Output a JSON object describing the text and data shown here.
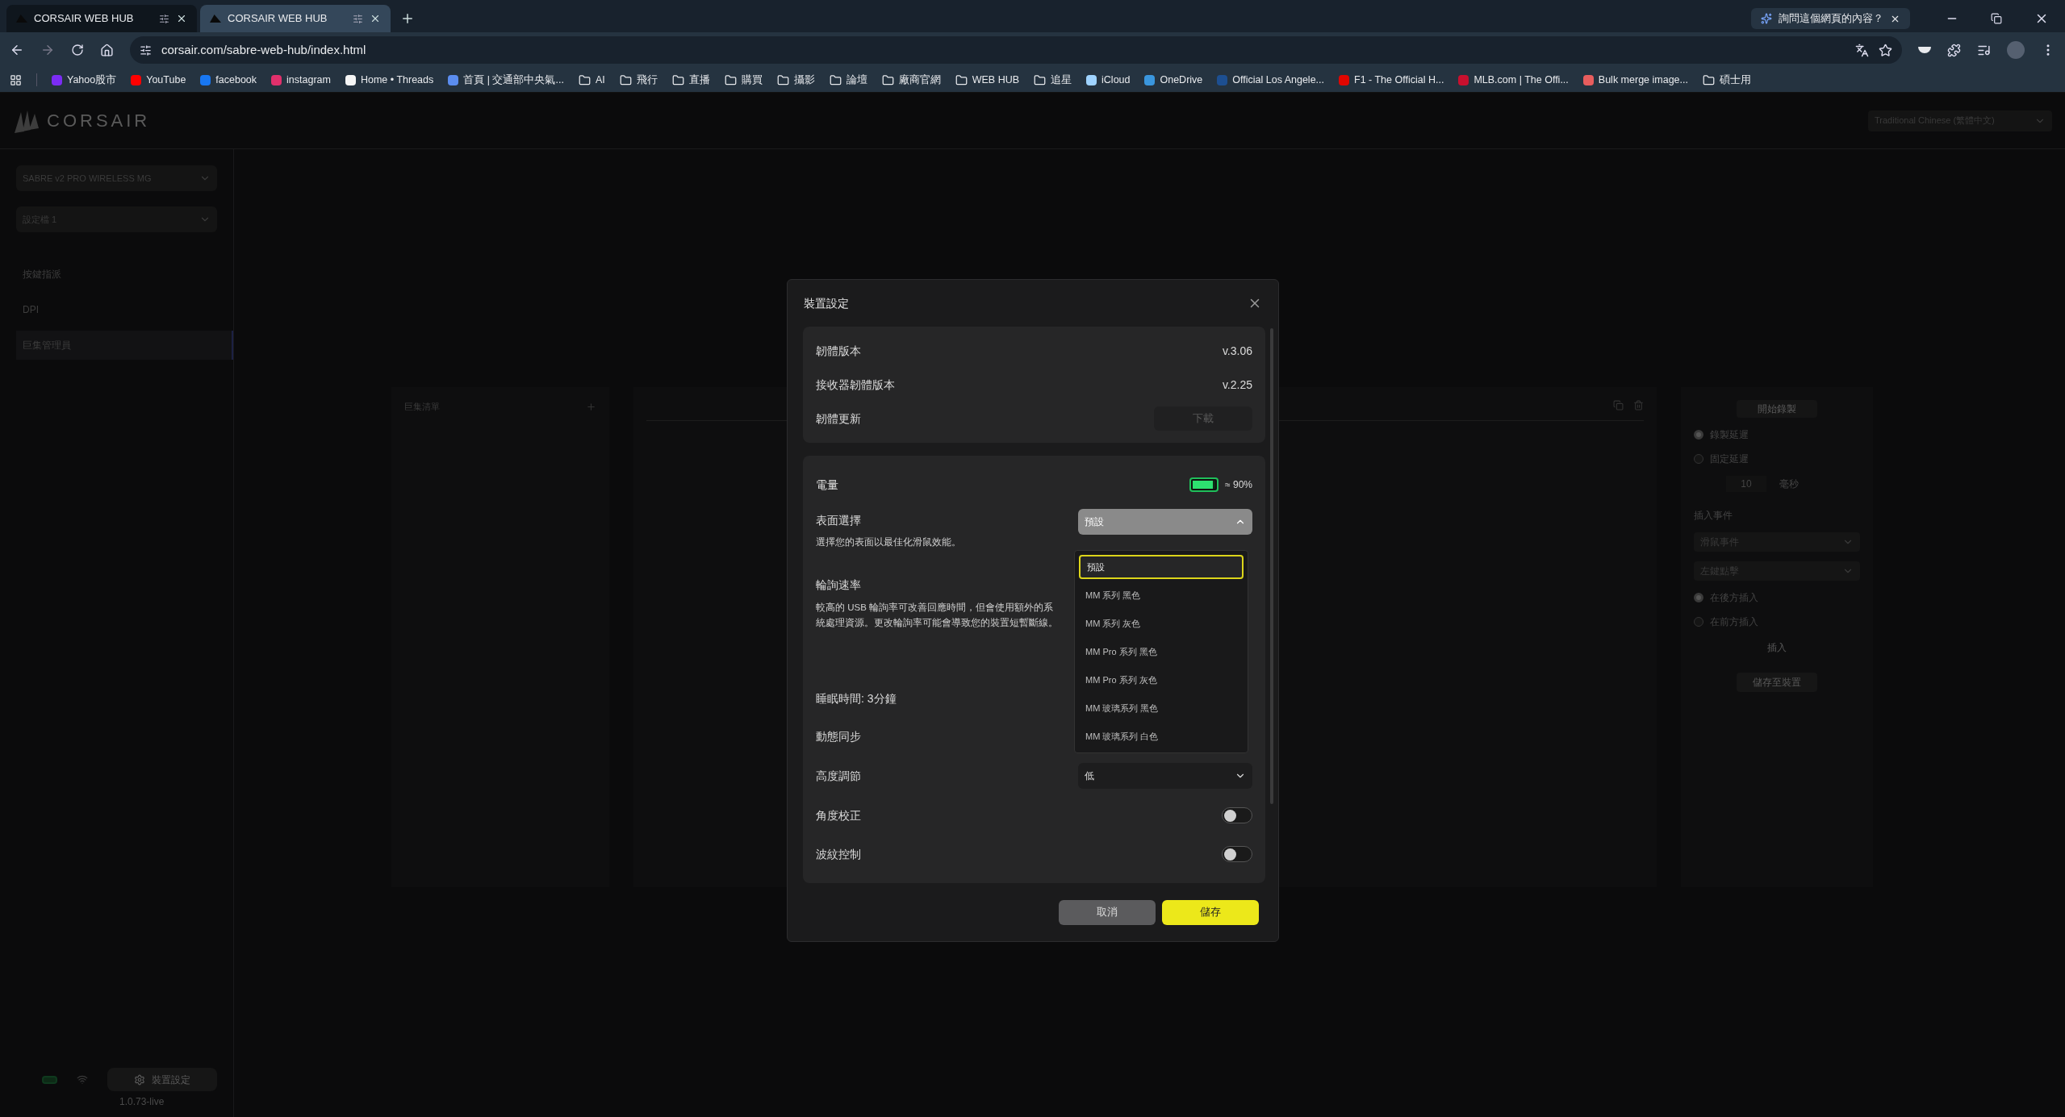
{
  "browser": {
    "tabs": [
      {
        "title": "CORSAIR WEB HUB",
        "selected": false
      },
      {
        "title": "CORSAIR WEB HUB",
        "selected": true
      }
    ],
    "address": "corsair.com/sabre-web-hub/index.html",
    "ask_prompt": "詢問這個網頁的內容？",
    "bookmarks": [
      {
        "label": "Yahoo股市",
        "kind": "site",
        "color": "#7b2cf5"
      },
      {
        "label": "YouTube",
        "kind": "site",
        "color": "#ff0000"
      },
      {
        "label": "facebook",
        "kind": "site",
        "color": "#1877f2"
      },
      {
        "label": "instagram",
        "kind": "site",
        "color": "#e1306c"
      },
      {
        "label": "Home • Threads",
        "kind": "site",
        "color": "#f5f5f5"
      },
      {
        "label": "首頁 | 交通部中央氣...",
        "kind": "site",
        "color": "#5b8def"
      },
      {
        "label": "AI",
        "kind": "folder"
      },
      {
        "label": "飛行",
        "kind": "folder"
      },
      {
        "label": "直播",
        "kind": "folder"
      },
      {
        "label": "購買",
        "kind": "folder"
      },
      {
        "label": "攝影",
        "kind": "folder"
      },
      {
        "label": "論壇",
        "kind": "folder"
      },
      {
        "label": "廠商官網",
        "kind": "folder"
      },
      {
        "label": "WEB HUB",
        "kind": "folder"
      },
      {
        "label": "追星",
        "kind": "folder"
      },
      {
        "label": "iCloud",
        "kind": "site",
        "color": "#9fd3ff"
      },
      {
        "label": "OneDrive",
        "kind": "site",
        "color": "#3a96dd"
      },
      {
        "label": "Official Los Angele...",
        "kind": "site",
        "color": "#1d4f91"
      },
      {
        "label": "F1 - The Official H...",
        "kind": "site",
        "color": "#e10600"
      },
      {
        "label": "MLB.com | The Offi...",
        "kind": "site",
        "color": "#c8102e"
      },
      {
        "label": "Bulk merge image...",
        "kind": "site",
        "color": "#e85d5d"
      },
      {
        "label": "碩士用",
        "kind": "folder"
      }
    ]
  },
  "app": {
    "logo_text": "CORSAIR",
    "language": "Traditional Chinese (繁體中文)",
    "device_select": "SABRE v2 PRO WIRELESS MG",
    "profile_select": "設定檔 1",
    "nav": [
      {
        "label": "按鍵指派",
        "selected": false
      },
      {
        "label": "DPI",
        "selected": false
      },
      {
        "label": "巨集管理員",
        "selected": true
      }
    ],
    "settings_button": "裝置設定",
    "version": "1.0.73-live",
    "macro_list_title": "巨集清單",
    "right_panel": {
      "record_button": "開始錄製",
      "delay_options": [
        {
          "label": "錄製延遲",
          "selected": true
        },
        {
          "label": "固定延遲",
          "selected": false
        }
      ],
      "delay_value": "10",
      "delay_unit": "毫秒",
      "insert_title": "插入事件",
      "selects": [
        "滑鼠事件",
        "左鍵點擊"
      ],
      "position_options": [
        {
          "label": "在後方插入",
          "selected": true
        },
        {
          "label": "在前方插入",
          "selected": false
        }
      ],
      "insert_button": "插入",
      "save_button": "儲存至裝置"
    }
  },
  "modal": {
    "title": "裝置設定",
    "info_rows": [
      {
        "label": "韌體版本",
        "value": "v.3.06",
        "kind": "text"
      },
      {
        "label": "接收器韌體版本",
        "value": "v.2.25",
        "kind": "text"
      },
      {
        "label": "韌體更新",
        "value": "下載",
        "kind": "button"
      }
    ],
    "battery": {
      "label": "電量",
      "reading": "≈ 90%",
      "level": 0.9
    },
    "surface": {
      "label": "表面選擇",
      "description": "選擇您的表面以最佳化滑鼠效能。",
      "value": "預設",
      "expanded": true,
      "options": [
        {
          "label": "預設",
          "selected": true
        },
        {
          "label": "MM 系列 黑色",
          "selected": false
        },
        {
          "label": "MM 系列 灰色",
          "selected": false
        },
        {
          "label": "MM Pro 系列 黑色",
          "selected": false
        },
        {
          "label": "MM Pro 系列 灰色",
          "selected": false
        },
        {
          "label": "MM 玻璃系列 黑色",
          "selected": false
        },
        {
          "label": "MM 玻璃系列 白色",
          "selected": false
        }
      ]
    },
    "polling": {
      "label": "輪詢速率",
      "description": "較高的 USB 輪詢率可改善回應時間，但會使用額外的系統處理資源。更改輪詢率可能會導致您的裝置短暫斷線。"
    },
    "sleep_label": "睡眠時間: 3分鐘",
    "motion_sync_label": "動態同步",
    "lift": {
      "label": "高度調節",
      "value": "低"
    },
    "toggles": [
      {
        "label": "角度校正",
        "on": false
      },
      {
        "label": "波紋控制",
        "on": false
      }
    ],
    "cancel": "取消",
    "save": "儲存"
  }
}
